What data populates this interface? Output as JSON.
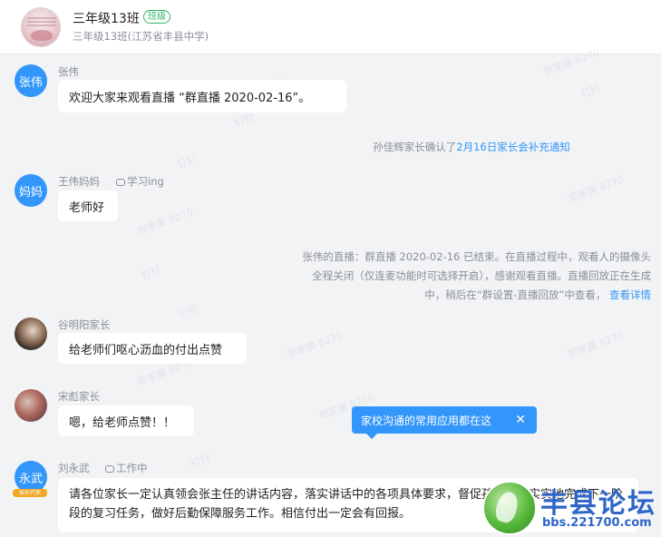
{
  "header": {
    "title": "三年级13班",
    "tag": "班级",
    "subtitle": "三年级13班(江苏省丰县中学)"
  },
  "messages": [
    {
      "avatar_text": "张伟",
      "sender": "张伟",
      "status": "",
      "text": "欢迎大家来观看直播 “群直播 2020-02-16”。"
    },
    {
      "avatar_text": "妈妈",
      "sender": "王伟妈妈",
      "status": "学习ing",
      "text": "老师好"
    },
    {
      "avatar_text": "",
      "sender": "谷明阳家长",
      "status": "",
      "text": "给老师们呕心沥血的付出点赞"
    },
    {
      "avatar_text": "",
      "sender": "宋彪家长",
      "status": "",
      "text": "嗯，给老师点赞！！"
    },
    {
      "avatar_text": "永武",
      "sender": "刘永武",
      "status": "工作中",
      "text": "请各位家长一定认真领会张主任的讲话内容，落实讲话中的各项具体要求，督促孩子踏踏实实地完成下一阶段的复习任务，做好后勤保障服务工作。相信付出一定会有回报。"
    }
  ],
  "system": {
    "notice1_prefix": "孙佳辉家长确认了",
    "notice1_link": "2月16日家长会补充通知",
    "notice2_line1": "张伟的直播：群直播 2020-02-16 已结束。在直播过程中，观看人的摄像头",
    "notice2_line2": "全程关闭（仅连麦功能时可选择开启），感谢观看直播。直播回放正在生成",
    "notice2_line3": "中，稍后在“群设置-直播回放”中查看，",
    "notice2_link": "查看详情"
  },
  "tooltip": {
    "text": "家校沟通的常用应用都在这",
    "close": "✕"
  },
  "badge": "家长代表",
  "watermark": {
    "name": "郭家晨 8270",
    "app": "钉钉"
  },
  "forum": {
    "name": "丰县论坛",
    "url": "bbs.221700.com"
  },
  "colors": {
    "accent": "#3296fa",
    "tag": "#35b66a",
    "background": "#f2f3f5"
  }
}
